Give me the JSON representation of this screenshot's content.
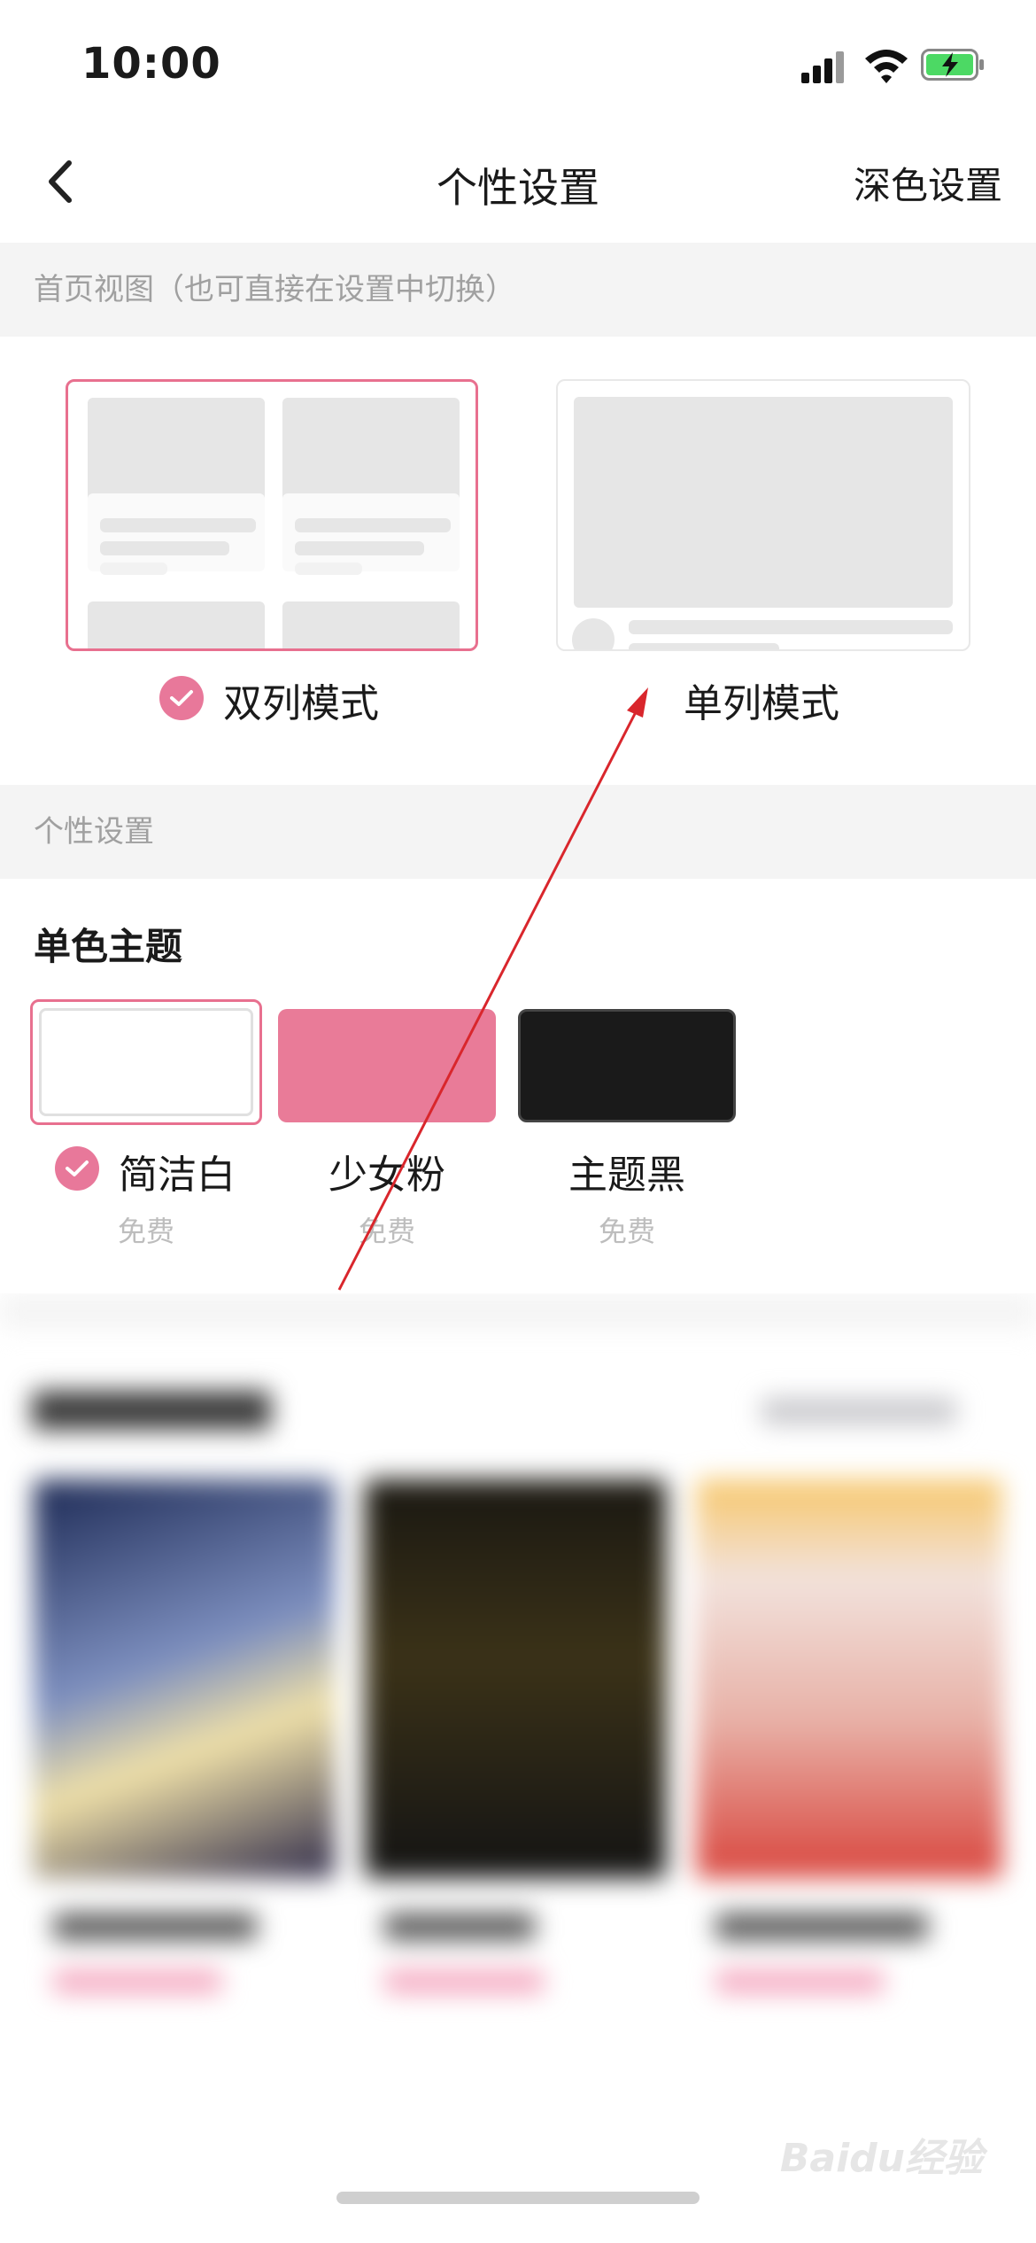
{
  "status_bar": {
    "time": "10:00",
    "battery_color": "#4cd964"
  },
  "nav": {
    "title": "个性设置",
    "right_action": "深色设置"
  },
  "home_view": {
    "section_title": "首页视图（也可直接在设置中切换）",
    "modes": [
      {
        "label": "双列模式",
        "selected": true
      },
      {
        "label": "单列模式",
        "selected": false
      }
    ]
  },
  "personal": {
    "section_title": "个性设置",
    "theme_title": "单色主题",
    "themes": [
      {
        "name": "简洁白",
        "price": "免费",
        "color": "#ffffff",
        "selected": true
      },
      {
        "name": "少女粉",
        "price": "免费",
        "color": "#e97b98",
        "selected": false
      },
      {
        "name": "主题黑",
        "price": "免费",
        "color": "#1a1a1a",
        "selected": false
      }
    ]
  },
  "accent_color": "#e8708f",
  "annotation_color": "#d9262c",
  "watermark": "Baidu经验"
}
